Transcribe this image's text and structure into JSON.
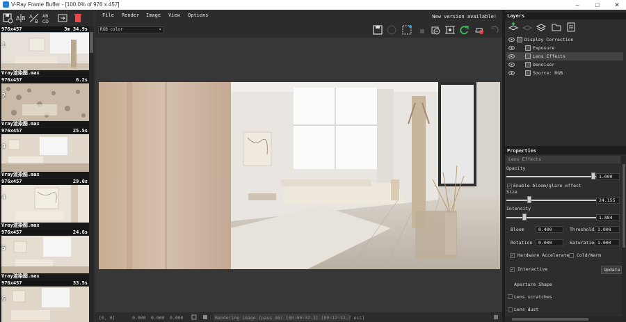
{
  "window": {
    "title": "V-Ray Frame Buffer - [100.0% of 976 x 457]",
    "minimize": "–",
    "maximize": "□",
    "close": "✕"
  },
  "menu": {
    "file": "File",
    "render": "Render",
    "image": "Image",
    "view": "View",
    "options": "Options",
    "new_version": "New version available!"
  },
  "channel_select": {
    "value": "RGB color"
  },
  "history": [
    {
      "resolution": "976x457",
      "time": "3m 34.9s",
      "index": "1",
      "filename": "Vray渲染图.max"
    },
    {
      "resolution": "976x457",
      "time": "6.2s",
      "index": "2",
      "filename": "Vray渲染图.max"
    },
    {
      "resolution": "976x457",
      "time": "25.5s",
      "index": "3",
      "filename": "Vray渲染图.max"
    },
    {
      "resolution": "976x457",
      "time": "29.0s",
      "index": "4",
      "filename": "Vray渲染图.max"
    },
    {
      "resolution": "976x457",
      "time": "24.6s",
      "index": "5",
      "filename": "Vray渲染图.max"
    },
    {
      "resolution": "976x457",
      "time": "33.5s",
      "index": "6",
      "filename": ""
    }
  ],
  "status": {
    "coords": "[0, 0]",
    "v1": "0.000",
    "v2": "0.000",
    "v3": "0.000",
    "progress_text": "Rendering image (pass 46) [00:00:32.3] [00:12:12.7 est]"
  },
  "layers": {
    "header": "Layers",
    "items": [
      {
        "label": "Display Correction"
      },
      {
        "label": "Exposure"
      },
      {
        "label": "Lens Effects"
      },
      {
        "label": "Denoiser"
      },
      {
        "label": "Source: RGB"
      }
    ]
  },
  "properties": {
    "header": "Properties",
    "section": "Lens Effects",
    "opacity_label": "Opacity",
    "opacity_value": "1.000",
    "opacity_level": 1.0,
    "enable_bloom": "Enable bloom/glare effect",
    "size_label": "Size",
    "size_value": "24.155",
    "intensity_label": "Intensity",
    "intensity_value": "1.884",
    "bloom_label": "Bloom",
    "bloom_value": "0.400",
    "threshold_label": "Threshold",
    "threshold_value": "1.000",
    "rotation_label": "Rotation",
    "rotation_value": "0.000",
    "saturation_label": "Saturation",
    "saturation_value": "1.000",
    "hw_accel": "Hardware Accelerated",
    "cold_warm": "Cold/Warm",
    "interactive": "Interactive",
    "update": "Update",
    "aperture_shape": "Aperture Shape",
    "lens_scratches": "Lens scratches",
    "lens_dust": "Lens dust"
  }
}
